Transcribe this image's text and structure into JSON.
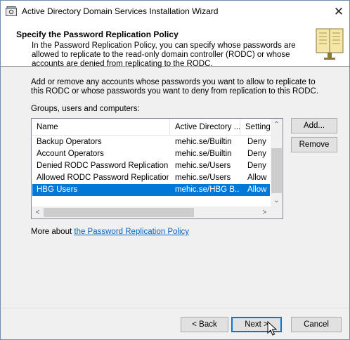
{
  "window": {
    "title": "Active Directory Domain Services Installation Wizard",
    "close_glyph": "✕",
    "icon": "wizard-app-icon"
  },
  "header": {
    "title": "Specify the Password Replication Policy",
    "description": "In the Password Replication Policy, you can specify whose passwords are allowed to replicate to the read-only domain controller (RODC) or whose accounts are denied from replicating to the RODC.",
    "icon": "book-icon"
  },
  "intro_text": "Add or remove any accounts whose passwords you want to allow to replicate to this RODC or whose passwords you want to deny from replication to this RODC.",
  "list": {
    "label": "Groups, users and computers:",
    "columns": [
      "Name",
      "Active Directory ...",
      "Setting"
    ],
    "rows": [
      {
        "name": "Backup Operators",
        "ad": "mehic.se/Builtin",
        "setting": "Deny",
        "selected": false
      },
      {
        "name": "Account Operators",
        "ad": "mehic.se/Builtin",
        "setting": "Deny",
        "selected": false
      },
      {
        "name": "Denied RODC Password Replication ...",
        "ad": "mehic.se/Users",
        "setting": "Deny",
        "selected": false
      },
      {
        "name": "Allowed RODC Password Replication ...",
        "ad": "mehic.se/Users",
        "setting": "Allow",
        "selected": false
      },
      {
        "name": "HBG Users",
        "ad": "mehic.se/HBG B...",
        "setting": "Allow",
        "selected": true
      }
    ],
    "scroll_up": "⌃",
    "scroll_down": "⌄",
    "scroll_left": "<",
    "scroll_right": ">"
  },
  "buttons": {
    "add": "Add...",
    "remove": "Remove",
    "back": "< Back",
    "next": "Next >",
    "cancel": "Cancel"
  },
  "more_about": {
    "prefix": "More about ",
    "link": "the Password Replication Policy"
  },
  "colors": {
    "accent": "#0078d7",
    "link": "#0066cc"
  }
}
